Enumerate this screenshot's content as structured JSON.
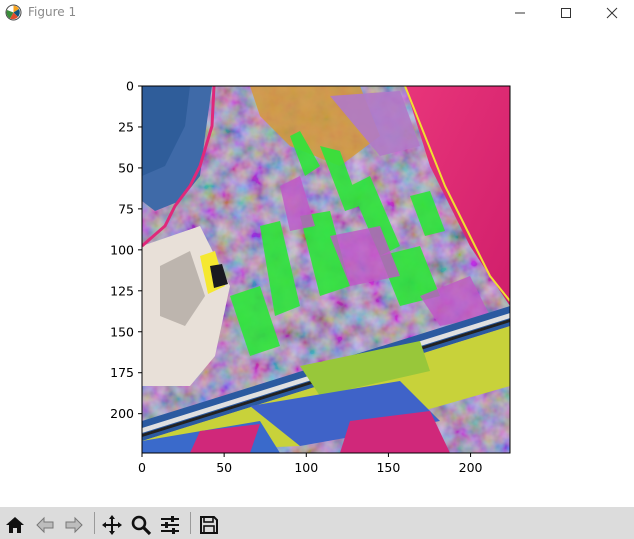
{
  "window": {
    "title": "Figure 1",
    "controls": [
      "minimize",
      "maximize",
      "close"
    ]
  },
  "chart_data": {
    "type": "image",
    "x_ticks": [
      "0",
      "50",
      "100",
      "150",
      "200"
    ],
    "y_ticks": [
      "0",
      "25",
      "50",
      "75",
      "100",
      "125",
      "150",
      "175",
      "200"
    ],
    "xlim": [
      0,
      224
    ],
    "ylim": [
      224,
      0
    ],
    "image_shape": [
      224,
      224
    ]
  },
  "toolbar": {
    "buttons": [
      "home-icon",
      "back-icon",
      "forward-icon",
      "pan-icon",
      "zoom-icon",
      "configure-subplots-icon",
      "save-icon"
    ]
  },
  "colors": {
    "toolbar_bg": "#dcdcdc",
    "titlebar_text": "#8a8a8a"
  }
}
